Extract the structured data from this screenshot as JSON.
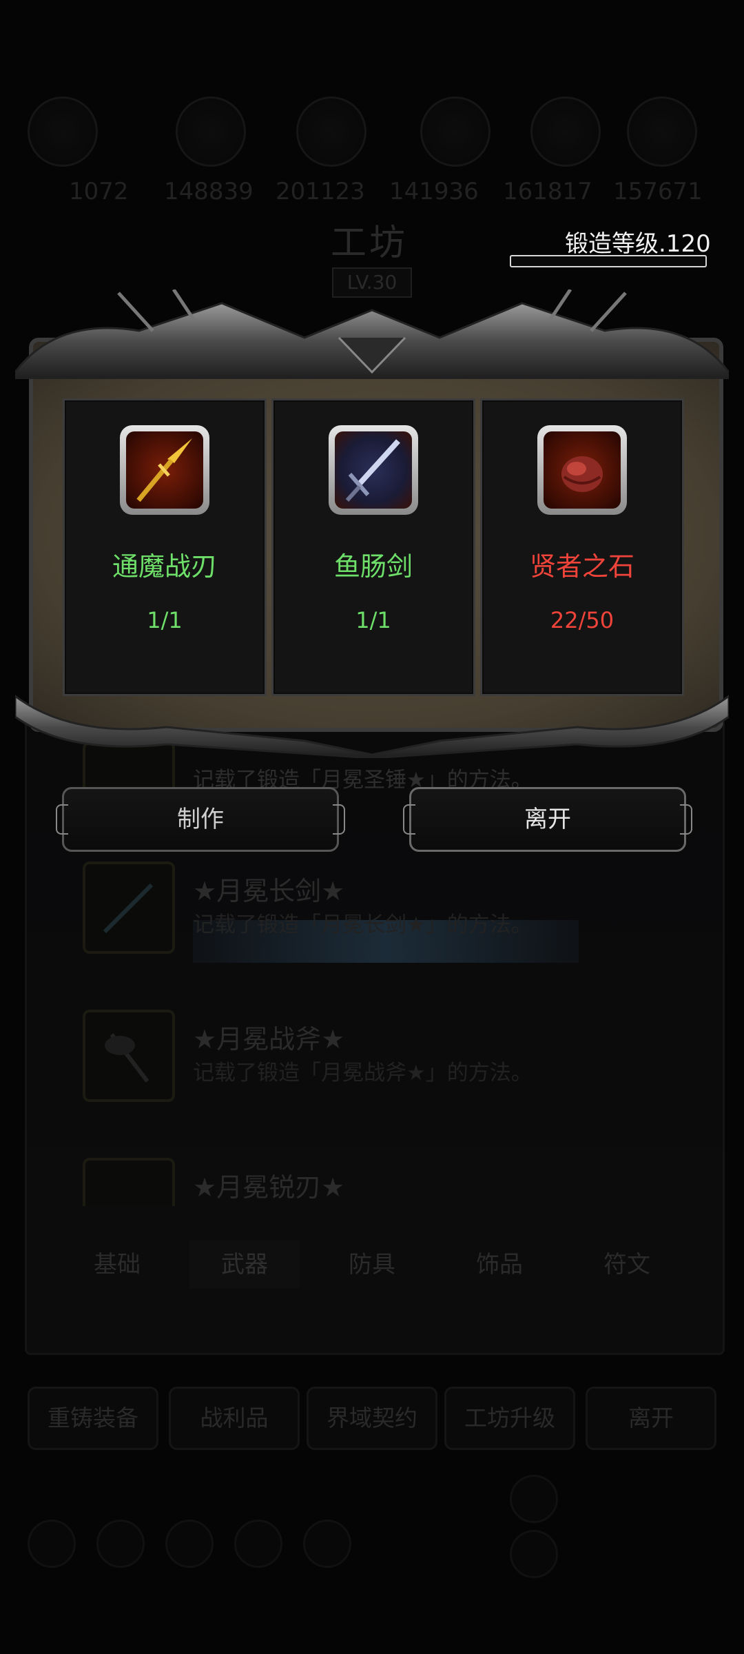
{
  "background": {
    "resource_values": [
      "1072",
      "148839",
      "201123",
      "141936",
      "161817",
      "157671"
    ],
    "workshop_title": "工坊",
    "workshop_level": "LV.30",
    "forge_level_text": "锻造等级.120",
    "recipes": [
      {
        "name": "",
        "desc": "记载了锻造「月冕圣锤★」的方法。",
        "icon": "hammer-icon"
      },
      {
        "name": "★月冕长剑★",
        "desc": "记载了锻造「月冕长剑★」的方法。",
        "icon": "sword-icon"
      },
      {
        "name": "★月冕战斧★",
        "desc": "记载了锻造「月冕战斧★」的方法。",
        "icon": "axe-icon"
      },
      {
        "name": "★月冕锐刃★",
        "desc": "",
        "icon": "blade-icon"
      }
    ],
    "category_tabs": [
      "基础",
      "武器",
      "防具",
      "饰品",
      "符文"
    ],
    "selected_tab": "武器",
    "bottom_buttons": [
      "重铸装备",
      "战利品",
      "界域契约",
      "工坊升级",
      "离开"
    ]
  },
  "modal": {
    "materials": [
      {
        "name": "通魔战刃",
        "count": "1/1",
        "status": "enough",
        "icon": "golden-spear-icon"
      },
      {
        "name": "鱼肠剑",
        "count": "1/1",
        "status": "enough",
        "icon": "blue-sword-icon"
      },
      {
        "name": "贤者之石",
        "count": "22/50",
        "status": "insufficient",
        "icon": "red-stone-icon"
      }
    ],
    "make_button": "制作",
    "leave_button": "离开"
  },
  "colors": {
    "enough": "#6ee06a",
    "insufficient": "#f0443a",
    "frame_bg": "#4e4536"
  }
}
